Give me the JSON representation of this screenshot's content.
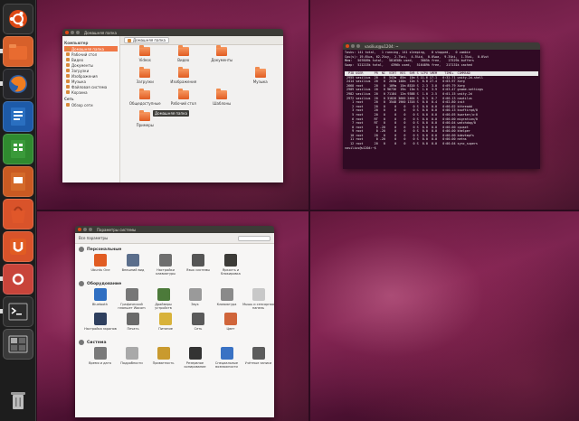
{
  "colors": {
    "launcher_bg": "#1d1d1d",
    "accent": "#e6a43c",
    "orange": "#f07746",
    "terminal_bg": "#300a24"
  },
  "launcher": {
    "items": [
      {
        "icon": "ubuntu-logo-icon"
      },
      {
        "icon": "home-folder-icon"
      },
      {
        "icon": "firefox-icon"
      },
      {
        "icon": "libreoffice-writer-icon"
      },
      {
        "icon": "libreoffice-calc-icon"
      },
      {
        "icon": "libreoffice-impress-icon"
      },
      {
        "icon": "software-center-icon"
      },
      {
        "icon": "ubuntu-one-icon"
      },
      {
        "icon": "system-settings-icon"
      },
      {
        "icon": "terminal-icon"
      },
      {
        "icon": "workspace-switcher-icon"
      },
      {
        "icon": "trash-icon"
      }
    ]
  },
  "file_manager": {
    "title": "Домашняя папка",
    "crumb": "Домашняя папка",
    "sidebar": {
      "computer_header": "Компьютер",
      "computer_items": [
        "Домашняя папка",
        "Рабочий стол",
        "Видео",
        "Документы",
        "Загрузки",
        "Изображения",
        "Музыка",
        "Файловая система",
        "Корзина"
      ],
      "network_header": "Сеть",
      "network_items": [
        "Обзор сети"
      ]
    },
    "folders": [
      "Videos",
      "Видео",
      "Документы",
      "",
      "Загрузки",
      "Изображения",
      "",
      "Музыка",
      "Общедоступные",
      "Рабочий стол",
      "Шаблоны",
      "",
      "Примеры"
    ],
    "tooltip": "Домашняя папка"
  },
  "terminal": {
    "title": "vasilius@u1204: ~",
    "lines": [
      "Tasks: 141 total,   1 running, 141 sleeping,   0 stopped,   0 zombie",
      "Cpu(s): 19.6%us, 62.2%sy,  2.7%ni,  4.5%id,  0.0%wa,  9.3%hi,  1.3%si,  0.0%st",
      "Mem:   507609k total,   581658k used,    3005k free,    17529k buffers",
      "Swap:  521215k total,    4396k used,   516489k free,   217131k cached",
      "",
      "  PID USER      PR  NI  VIRT  RES  SHR S %CPU %MEM    TIME+  COMMAND",
      " 2955 vasilius  20   0  543m  85m  15m S 11.6 17.1   0:32.71 unity-2d-shell",
      " 2414 vasilius  20   0  263m 140m  12m S  6.0 27.4   0:03.97 Xorg",
      " 2668 root      20   0  109m  15m 8520 S  2.3  3.0   0:09.79 Xorg",
      " 2909 vasilius  20   0 96736  19m  13m S  1.6  3.9   0:03.47 gnome-settings",
      " 2982 vasilius  20   0 71184  12m 9388 S  1.0  2.5   0:01.15 unity-2d",
      " 2972 vasilius  20   0 31828 3660 2464 S  0.3  0.7   0:00.13 nautilus",
      "    1 root      20   0  3548 1960 1316 S  0.0  0.4   0:02.80 init",
      "    2 root      20   0     0    0    0 S  0.0  0.0   0:00.02 kthreadd",
      "    3 root      20   0     0    0    0 S  0.0  0.0   0:00.13 ksoftirqd/0",
      "    5 root      20   0     0    0    0 S  0.0  0.0   0:00.05 kworker/u:0",
      "    6 root      RT   0     0    0    0 S  0.0  0.0   0:00.00 migration/0",
      "    7 root      RT   0     0    0    0 S  0.0  0.0   0:00.04 watchdog/0",
      "    8 root       0 -20     0    0    0 S  0.0  0.0   0:00.00 cpuset",
      "    9 root       0 -20     0    0    0 S  0.0  0.0   0:00.00 khelper",
      "   10 root      20   0     0    0    0 S  0.0  0.0   0:00.00 kdevtmpfs",
      "   11 root       0 -20     0    0    0 S  0.0  0.0   0:00.00 netns",
      "   12 root      20   0     0    0    0 S  0.0  0.0   0:00.04 sync_supers",
      "vasilius@u1204:~$ "
    ]
  },
  "settings": {
    "title": "Параметры системы",
    "all_label": "Все параметры",
    "sections": [
      {
        "name": "Персональные",
        "items": [
          {
            "label": "Ubuntu One",
            "icon": "ubuntu-one-icon",
            "color": "#e15c22"
          },
          {
            "label": "Внешний вид",
            "icon": "appearance-icon",
            "color": "#5b6e8c"
          },
          {
            "label": "Настройки клавиатуры",
            "icon": "keyboard-icon",
            "color": "#6f6f6f"
          },
          {
            "label": "Язык системы",
            "icon": "language-icon",
            "color": "#555555"
          },
          {
            "label": "Яркость и блокировка",
            "icon": "brightness-icon",
            "color": "#3c3b37"
          }
        ]
      },
      {
        "name": "Оборудование",
        "items": [
          {
            "label": "Bluetooth",
            "icon": "bluetooth-icon",
            "color": "#2f6fc2"
          },
          {
            "label": "Графический планшет Wacom",
            "icon": "wacom-icon",
            "color": "#777777"
          },
          {
            "label": "Драйверы устройств",
            "icon": "drivers-icon",
            "color": "#4c7a3a"
          },
          {
            "label": "Звук",
            "icon": "sound-icon",
            "color": "#9a9a9a"
          },
          {
            "label": "Клавиатура",
            "icon": "keyboard-icon",
            "color": "#8a8a8a"
          },
          {
            "label": "Мышь и сенсорная панель",
            "icon": "mouse-icon",
            "color": "#c8c8c8"
          }
        ]
      },
      {
        "name": "",
        "items": [
          {
            "label": "Настройка экранов",
            "icon": "display-icon",
            "color": "#2e3f5e"
          },
          {
            "label": "Печать",
            "icon": "printer-icon",
            "color": "#6a6a6a"
          },
          {
            "label": "Питание",
            "icon": "power-icon",
            "color": "#d8b23a"
          },
          {
            "label": "Сеть",
            "icon": "network-icon",
            "color": "#5a5a5a"
          },
          {
            "label": "Цвет",
            "icon": "color-icon",
            "color": "#d0653a"
          }
        ]
      },
      {
        "name": "Система",
        "items": [
          {
            "label": "Время и дата",
            "icon": "clock-icon",
            "color": "#7a7a7a"
          },
          {
            "label": "Подробности",
            "icon": "details-icon",
            "color": "#a9a9a9"
          },
          {
            "label": "Приватность",
            "icon": "privacy-icon",
            "color": "#c99a2e"
          },
          {
            "label": "Резервное копирование",
            "icon": "backup-icon",
            "color": "#333333"
          },
          {
            "label": "Специальные возможности",
            "icon": "accessibility-icon",
            "color": "#3a72c4"
          },
          {
            "label": "Учётные записи",
            "icon": "users-icon",
            "color": "#5c5c5c"
          }
        ]
      }
    ]
  }
}
